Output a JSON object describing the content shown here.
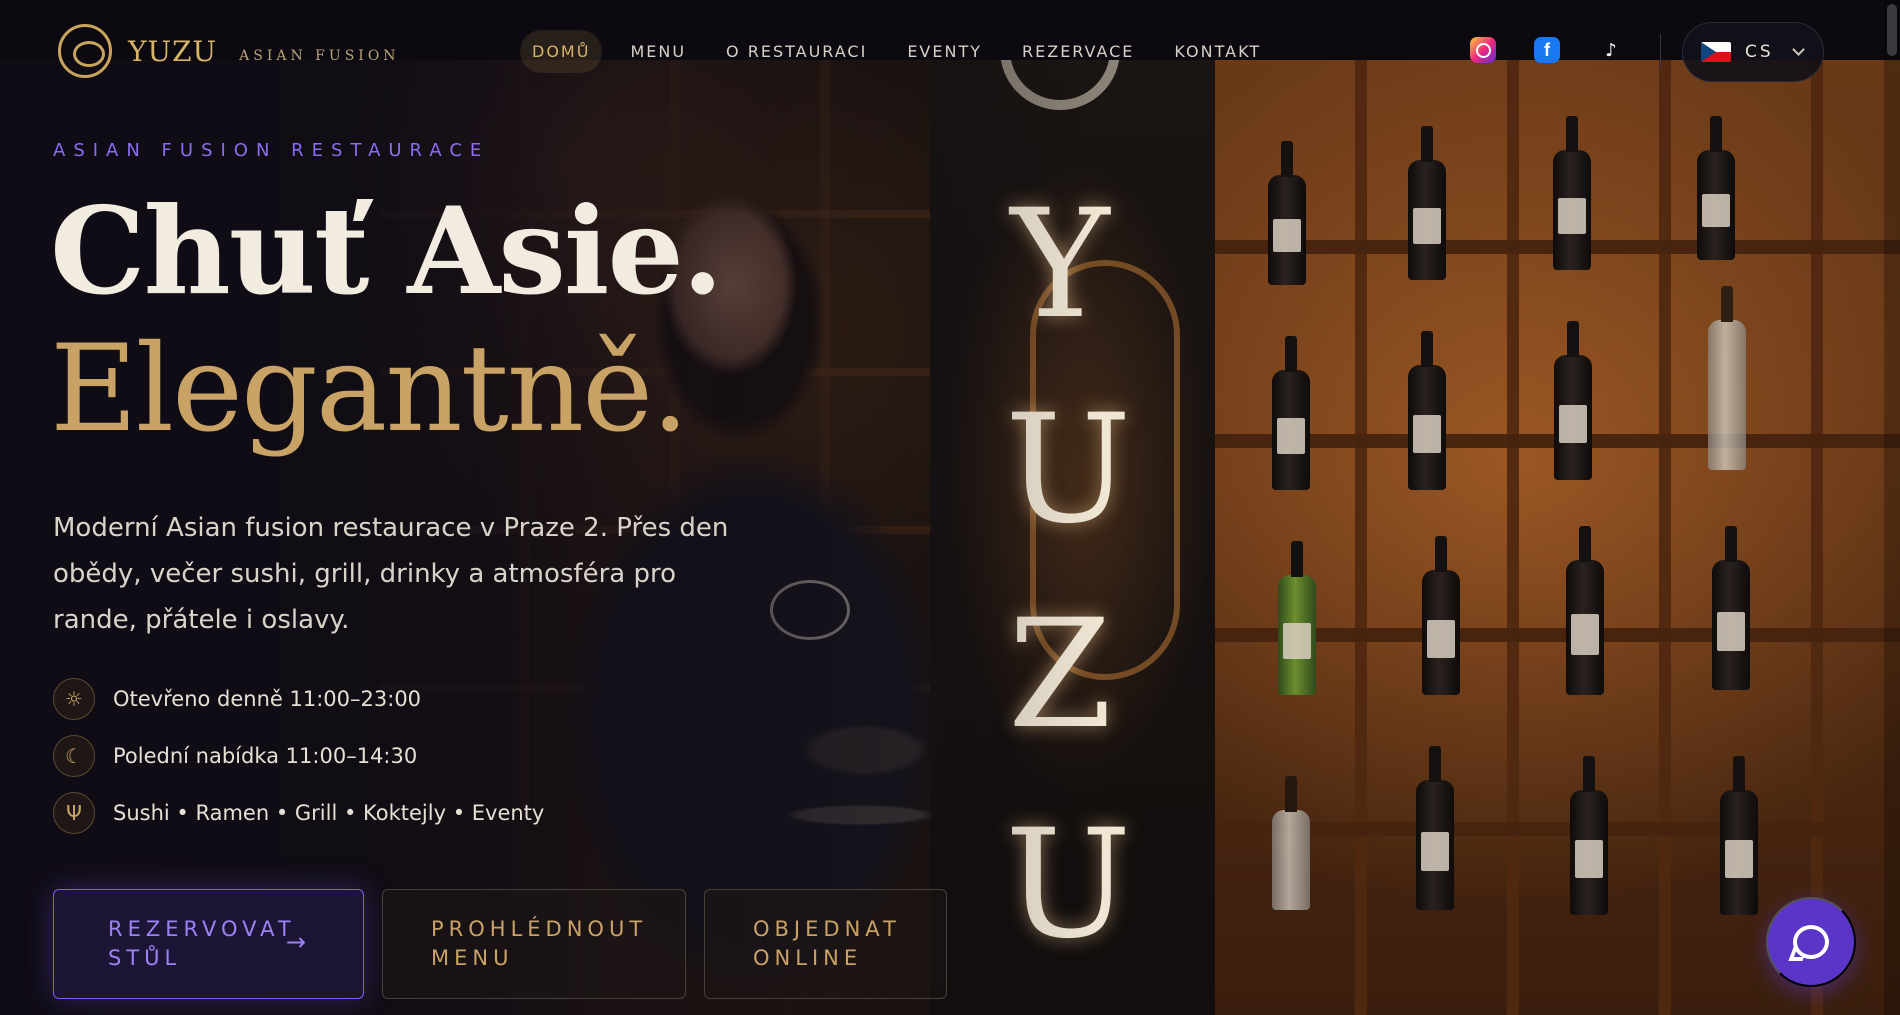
{
  "brand": {
    "name": "YUZU",
    "tagline": "ASIAN FUSION"
  },
  "nav": {
    "items": [
      {
        "label": "DOMŮ",
        "active": true
      },
      {
        "label": "MENU"
      },
      {
        "label": "O RESTAURACI"
      },
      {
        "label": "EVENTY"
      },
      {
        "label": "REZERVACE"
      },
      {
        "label": "KONTAKT"
      }
    ],
    "socials": [
      "instagram-icon",
      "facebook-icon",
      "tiktok-icon"
    ],
    "language": {
      "code": "CS",
      "flag": "czech-flag-icon"
    }
  },
  "background_sign": {
    "letters": [
      "Y",
      "U",
      "Z",
      "U"
    ]
  },
  "hero": {
    "eyebrow": "ASIAN FUSION RESTAURACE",
    "title_line1": "Chuť Asie.",
    "title_line2": "Elegantně.",
    "lead": "Moderní Asian fusion restaurace v Praze 2. Přes den obědy, večer sushi, grill, drinky a atmosféra pro rande, přátele i oslavy.",
    "features": [
      {
        "icon": "sun-icon",
        "text": "Otevřeno denně 11:00–23:00"
      },
      {
        "icon": "moon-icon",
        "text": "Polední nabídka 11:00–14:30"
      },
      {
        "icon": "utensils-icon",
        "text": "Sushi • Ramen • Grill • Koktejly • Eventy"
      }
    ],
    "buttons": {
      "reserve_line1": "REZERVOVAT",
      "reserve_line2": "STŮL",
      "reserve_arrow": "→",
      "menu_line1": "PROHLÉDNOUT",
      "menu_line2": "MENU",
      "order_line1": "OBJEDNAT",
      "order_line2": "ONLINE"
    }
  },
  "colors": {
    "accent_gold": "#c9a265",
    "accent_purple": "#7b5cf0",
    "chat_button": "#5a35c8",
    "background": "#0d0b10"
  }
}
